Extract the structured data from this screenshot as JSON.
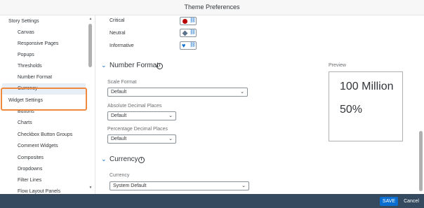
{
  "window": {
    "title": "Theme Preferences"
  },
  "sidebar": {
    "items": [
      {
        "label": "Story Settings",
        "level": "section"
      },
      {
        "label": "Canvas",
        "level": "child"
      },
      {
        "label": "Responsive Pages",
        "level": "child"
      },
      {
        "label": "Popups",
        "level": "child"
      },
      {
        "label": "Thresholds",
        "level": "child"
      },
      {
        "label": "Number Format",
        "level": "child"
      },
      {
        "label": "Currency",
        "level": "child",
        "selected": true
      },
      {
        "label": "Widget Settings",
        "level": "section"
      },
      {
        "label": "Buttons",
        "level": "child"
      },
      {
        "label": "Charts",
        "level": "child"
      },
      {
        "label": "Checkbox Button Groups",
        "level": "child"
      },
      {
        "label": "Comment Widgets",
        "level": "child"
      },
      {
        "label": "Composites",
        "level": "child"
      },
      {
        "label": "Dropdowns",
        "level": "child"
      },
      {
        "label": "Filter Lines",
        "level": "child"
      },
      {
        "label": "Flow Layout Panels",
        "level": "child"
      }
    ]
  },
  "thresholds": {
    "rows": [
      {
        "label": "Critical",
        "icon": "circle-icon",
        "color": "#bb0000"
      },
      {
        "label": "Neutral",
        "icon": "diamond-icon",
        "color": "#5b738b"
      },
      {
        "label": "Informative",
        "icon": "heart-icon",
        "color": "#0a6ed1"
      }
    ],
    "link_glyph": "⛓"
  },
  "number_format": {
    "title": "Number Format",
    "scale_format": {
      "label": "Scale Format",
      "value": "Default"
    },
    "absolute_decimals": {
      "label": "Absolute Decimal Places",
      "value": "Default"
    },
    "percentage_decimals": {
      "label": "Percentage Decimal Places",
      "value": "Default"
    }
  },
  "preview": {
    "label": "Preview",
    "value1": "100 Million",
    "value2": "50%"
  },
  "currency": {
    "title": "Currency",
    "field": {
      "label": "Currency",
      "value": "System Default"
    }
  },
  "footer": {
    "save_label": "SAVE",
    "cancel_label": "Cancel"
  },
  "colors": {
    "accent": "#0a6ed1",
    "footer_bg": "#354a5f",
    "highlight": "#f0883e"
  }
}
